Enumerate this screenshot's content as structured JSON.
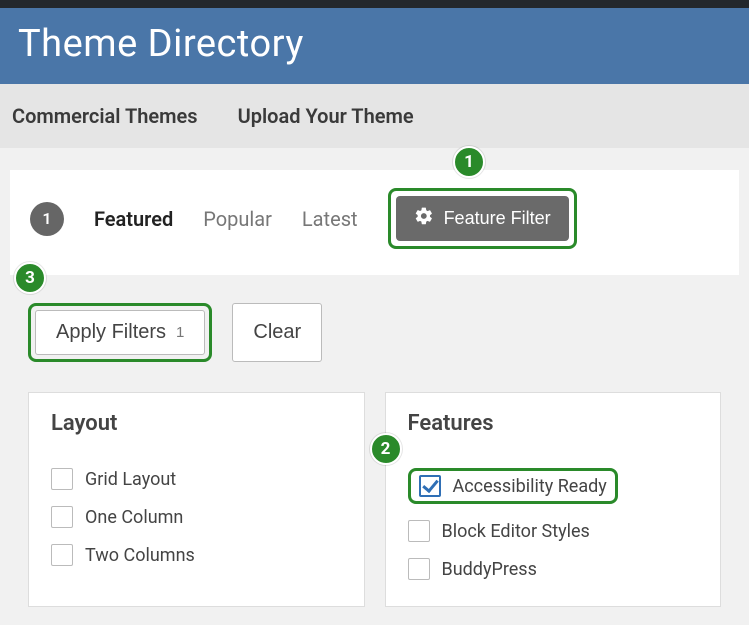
{
  "header": {
    "title": "Theme Directory"
  },
  "subnav": {
    "commercial": "Commercial Themes",
    "upload": "Upload Your Theme"
  },
  "tabs": {
    "count": "1",
    "featured": "Featured",
    "popular": "Popular",
    "latest": "Latest",
    "filter_button": "Feature Filter"
  },
  "filters": {
    "apply_label": "Apply Filters",
    "apply_count": "1",
    "clear_label": "Clear"
  },
  "layout_group": {
    "title": "Layout",
    "items": [
      {
        "label": "Grid Layout",
        "checked": false
      },
      {
        "label": "One Column",
        "checked": false
      },
      {
        "label": "Two Columns",
        "checked": false
      }
    ]
  },
  "features_group": {
    "title": "Features",
    "items": [
      {
        "label": "Accessibility Ready",
        "checked": true
      },
      {
        "label": "Block Editor Styles",
        "checked": false
      },
      {
        "label": "BuddyPress",
        "checked": false
      }
    ]
  },
  "annotations": {
    "a1": "1",
    "a2": "2",
    "a3": "3"
  }
}
